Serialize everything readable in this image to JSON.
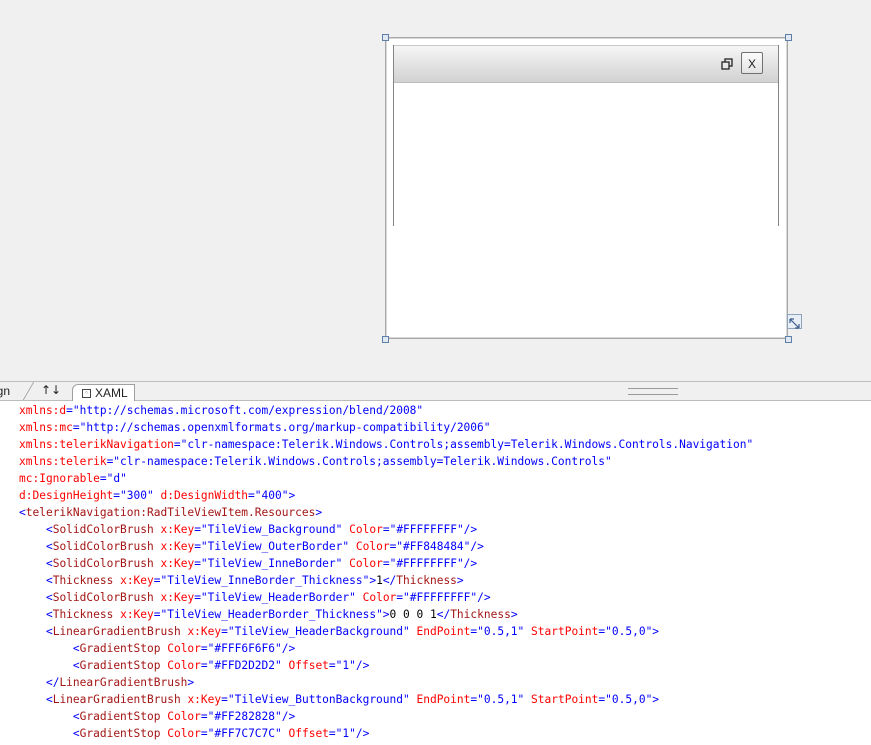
{
  "designer": {
    "close_label": "X"
  },
  "tabs": {
    "design_label": "ign",
    "swap_label": "↑↓",
    "xaml_label": "XAML"
  },
  "code_lines": [
    [
      {
        "c": "a",
        "s": "xmlns:d"
      },
      {
        "c": "p",
        "s": "=\""
      },
      {
        "c": "v",
        "s": "http://schemas.microsoft.com/expression/blend/2008"
      },
      {
        "c": "p",
        "s": "\""
      }
    ],
    [
      {
        "c": "a",
        "s": "xmlns:mc"
      },
      {
        "c": "p",
        "s": "=\""
      },
      {
        "c": "v",
        "s": "http://schemas.openxmlformats.org/markup-compatibility/2006"
      },
      {
        "c": "p",
        "s": "\""
      }
    ],
    [
      {
        "c": "a",
        "s": "xmlns:telerikNavigation"
      },
      {
        "c": "p",
        "s": "=\""
      },
      {
        "c": "v",
        "s": "clr-namespace:Telerik.Windows.Controls;assembly=Telerik.Windows.Controls.Navigation"
      },
      {
        "c": "p",
        "s": "\""
      }
    ],
    [
      {
        "c": "a",
        "s": "xmlns:telerik"
      },
      {
        "c": "p",
        "s": "=\""
      },
      {
        "c": "v",
        "s": "clr-namespace:Telerik.Windows.Controls;assembly=Telerik.Windows.Controls"
      },
      {
        "c": "p",
        "s": "\""
      }
    ],
    [
      {
        "c": "a",
        "s": "mc:Ignorable"
      },
      {
        "c": "p",
        "s": "=\""
      },
      {
        "c": "v",
        "s": "d"
      },
      {
        "c": "p",
        "s": "\""
      }
    ],
    [
      {
        "c": "a",
        "s": "d:DesignHeight"
      },
      {
        "c": "p",
        "s": "=\""
      },
      {
        "c": "v",
        "s": "300"
      },
      {
        "c": "p",
        "s": "\" "
      },
      {
        "c": "a",
        "s": "d:DesignWidth"
      },
      {
        "c": "p",
        "s": "=\""
      },
      {
        "c": "v",
        "s": "400"
      },
      {
        "c": "p",
        "s": "\">"
      }
    ],
    [
      {
        "c": "p",
        "s": "<"
      },
      {
        "c": "n",
        "s": "telerikNavigation:RadTileViewItem.Resources"
      },
      {
        "c": "p",
        "s": ">"
      }
    ],
    [
      {
        "c": "x",
        "s": "    "
      },
      {
        "c": "p",
        "s": "<"
      },
      {
        "c": "n",
        "s": "SolidColorBrush"
      },
      {
        "c": "x",
        "s": " "
      },
      {
        "c": "a",
        "s": "x:Key"
      },
      {
        "c": "p",
        "s": "=\""
      },
      {
        "c": "v",
        "s": "TileView_Background"
      },
      {
        "c": "p",
        "s": "\" "
      },
      {
        "c": "a",
        "s": "Color"
      },
      {
        "c": "p",
        "s": "=\""
      },
      {
        "c": "v",
        "s": "#FFFFFFFF"
      },
      {
        "c": "p",
        "s": "\"/>"
      }
    ],
    [
      {
        "c": "x",
        "s": "    "
      },
      {
        "c": "p",
        "s": "<"
      },
      {
        "c": "n",
        "s": "SolidColorBrush"
      },
      {
        "c": "x",
        "s": " "
      },
      {
        "c": "a",
        "s": "x:Key"
      },
      {
        "c": "p",
        "s": "=\""
      },
      {
        "c": "v",
        "s": "TileView_OuterBorder"
      },
      {
        "c": "p",
        "s": "\" "
      },
      {
        "c": "a",
        "s": "Color"
      },
      {
        "c": "p",
        "s": "=\""
      },
      {
        "c": "v",
        "s": "#FF848484"
      },
      {
        "c": "p",
        "s": "\"/>"
      }
    ],
    [
      {
        "c": "x",
        "s": "    "
      },
      {
        "c": "p",
        "s": "<"
      },
      {
        "c": "n",
        "s": "SolidColorBrush"
      },
      {
        "c": "x",
        "s": " "
      },
      {
        "c": "a",
        "s": "x:Key"
      },
      {
        "c": "p",
        "s": "=\""
      },
      {
        "c": "v",
        "s": "TileView_InneBorder"
      },
      {
        "c": "p",
        "s": "\" "
      },
      {
        "c": "a",
        "s": "Color"
      },
      {
        "c": "p",
        "s": "=\""
      },
      {
        "c": "v",
        "s": "#FFFFFFFF"
      },
      {
        "c": "p",
        "s": "\"/>"
      }
    ],
    [
      {
        "c": "x",
        "s": "    "
      },
      {
        "c": "p",
        "s": "<"
      },
      {
        "c": "n",
        "s": "Thickness"
      },
      {
        "c": "x",
        "s": " "
      },
      {
        "c": "a",
        "s": "x:Key"
      },
      {
        "c": "p",
        "s": "=\""
      },
      {
        "c": "v",
        "s": "TileView_InneBorder_Thickness"
      },
      {
        "c": "p",
        "s": "\">"
      },
      {
        "c": "x",
        "s": "1"
      },
      {
        "c": "p",
        "s": "</"
      },
      {
        "c": "n",
        "s": "Thickness"
      },
      {
        "c": "p",
        "s": ">"
      }
    ],
    [
      {
        "c": "x",
        "s": "    "
      },
      {
        "c": "p",
        "s": "<"
      },
      {
        "c": "n",
        "s": "SolidColorBrush"
      },
      {
        "c": "x",
        "s": " "
      },
      {
        "c": "a",
        "s": "x:Key"
      },
      {
        "c": "p",
        "s": "=\""
      },
      {
        "c": "v",
        "s": "TileView_HeaderBorder"
      },
      {
        "c": "p",
        "s": "\" "
      },
      {
        "c": "a",
        "s": "Color"
      },
      {
        "c": "p",
        "s": "=\""
      },
      {
        "c": "v",
        "s": "#FFFFFFFF"
      },
      {
        "c": "p",
        "s": "\"/>"
      }
    ],
    [
      {
        "c": "x",
        "s": "    "
      },
      {
        "c": "p",
        "s": "<"
      },
      {
        "c": "n",
        "s": "Thickness"
      },
      {
        "c": "x",
        "s": " "
      },
      {
        "c": "a",
        "s": "x:Key"
      },
      {
        "c": "p",
        "s": "=\""
      },
      {
        "c": "v",
        "s": "TileView_HeaderBorder_Thickness"
      },
      {
        "c": "p",
        "s": "\">"
      },
      {
        "c": "x",
        "s": "0 0 0 1"
      },
      {
        "c": "p",
        "s": "</"
      },
      {
        "c": "n",
        "s": "Thickness"
      },
      {
        "c": "p",
        "s": ">"
      }
    ],
    [
      {
        "c": "x",
        "s": "    "
      },
      {
        "c": "p",
        "s": "<"
      },
      {
        "c": "n",
        "s": "LinearGradientBrush"
      },
      {
        "c": "x",
        "s": " "
      },
      {
        "c": "a",
        "s": "x:Key"
      },
      {
        "c": "p",
        "s": "=\""
      },
      {
        "c": "v",
        "s": "TileView_HeaderBackground"
      },
      {
        "c": "p",
        "s": "\" "
      },
      {
        "c": "a",
        "s": "EndPoint"
      },
      {
        "c": "p",
        "s": "=\""
      },
      {
        "c": "v",
        "s": "0.5,1"
      },
      {
        "c": "p",
        "s": "\" "
      },
      {
        "c": "a",
        "s": "StartPoint"
      },
      {
        "c": "p",
        "s": "=\""
      },
      {
        "c": "v",
        "s": "0.5,0"
      },
      {
        "c": "p",
        "s": "\">"
      }
    ],
    [
      {
        "c": "x",
        "s": "        "
      },
      {
        "c": "p",
        "s": "<"
      },
      {
        "c": "n",
        "s": "GradientStop"
      },
      {
        "c": "x",
        "s": " "
      },
      {
        "c": "a",
        "s": "Color"
      },
      {
        "c": "p",
        "s": "=\""
      },
      {
        "c": "v",
        "s": "#FFF6F6F6"
      },
      {
        "c": "p",
        "s": "\"/>"
      }
    ],
    [
      {
        "c": "x",
        "s": "        "
      },
      {
        "c": "p",
        "s": "<"
      },
      {
        "c": "n",
        "s": "GradientStop"
      },
      {
        "c": "x",
        "s": " "
      },
      {
        "c": "a",
        "s": "Color"
      },
      {
        "c": "p",
        "s": "=\""
      },
      {
        "c": "v",
        "s": "#FFD2D2D2"
      },
      {
        "c": "p",
        "s": "\" "
      },
      {
        "c": "a",
        "s": "Offset"
      },
      {
        "c": "p",
        "s": "=\""
      },
      {
        "c": "v",
        "s": "1"
      },
      {
        "c": "p",
        "s": "\"/>"
      }
    ],
    [
      {
        "c": "x",
        "s": "    "
      },
      {
        "c": "p",
        "s": "</"
      },
      {
        "c": "n",
        "s": "LinearGradientBrush"
      },
      {
        "c": "p",
        "s": ">"
      }
    ],
    [
      {
        "c": "x",
        "s": "    "
      },
      {
        "c": "p",
        "s": "<"
      },
      {
        "c": "n",
        "s": "LinearGradientBrush"
      },
      {
        "c": "x",
        "s": " "
      },
      {
        "c": "a",
        "s": "x:Key"
      },
      {
        "c": "p",
        "s": "=\""
      },
      {
        "c": "v",
        "s": "TileView_ButtonBackground"
      },
      {
        "c": "p",
        "s": "\" "
      },
      {
        "c": "a",
        "s": "EndPoint"
      },
      {
        "c": "p",
        "s": "=\""
      },
      {
        "c": "v",
        "s": "0.5,1"
      },
      {
        "c": "p",
        "s": "\" "
      },
      {
        "c": "a",
        "s": "StartPoint"
      },
      {
        "c": "p",
        "s": "=\""
      },
      {
        "c": "v",
        "s": "0.5,0"
      },
      {
        "c": "p",
        "s": "\">"
      }
    ],
    [
      {
        "c": "x",
        "s": "        "
      },
      {
        "c": "p",
        "s": "<"
      },
      {
        "c": "n",
        "s": "GradientStop"
      },
      {
        "c": "x",
        "s": " "
      },
      {
        "c": "a",
        "s": "Color"
      },
      {
        "c": "p",
        "s": "=\""
      },
      {
        "c": "v",
        "s": "#FF282828"
      },
      {
        "c": "p",
        "s": "\"/>"
      }
    ],
    [
      {
        "c": "x",
        "s": "        "
      },
      {
        "c": "p",
        "s": "<"
      },
      {
        "c": "n",
        "s": "GradientStop"
      },
      {
        "c": "x",
        "s": " "
      },
      {
        "c": "a",
        "s": "Color"
      },
      {
        "c": "p",
        "s": "=\""
      },
      {
        "c": "v",
        "s": "#FF7C7C7C"
      },
      {
        "c": "p",
        "s": "\" "
      },
      {
        "c": "a",
        "s": "Offset"
      },
      {
        "c": "p",
        "s": "=\""
      },
      {
        "c": "v",
        "s": "1"
      },
      {
        "c": "p",
        "s": "\"/>"
      }
    ]
  ]
}
